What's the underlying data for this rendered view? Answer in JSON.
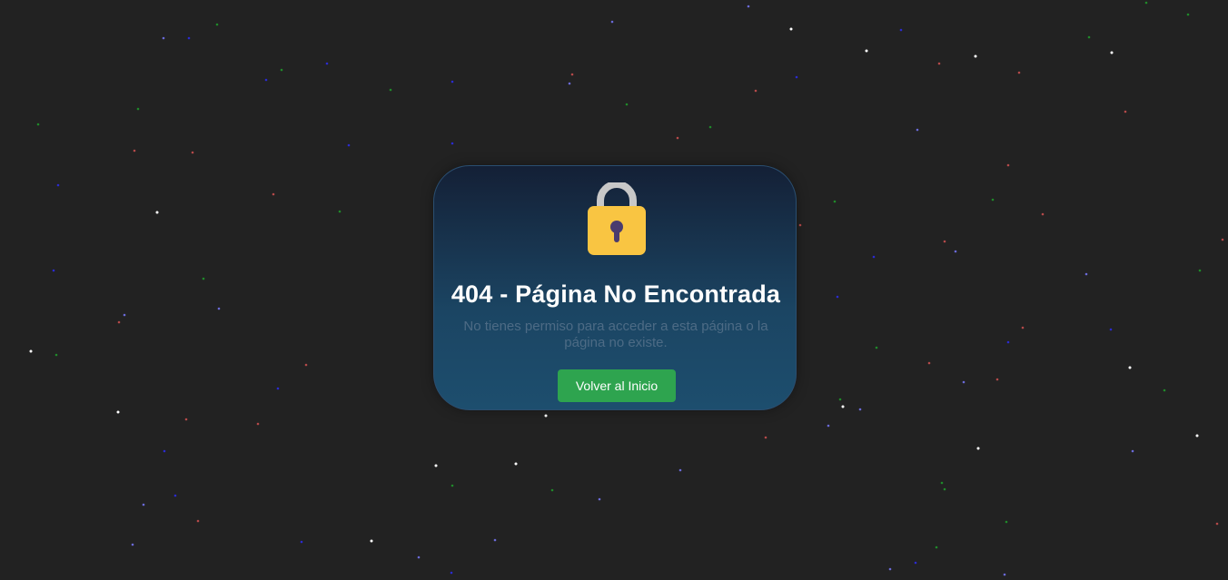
{
  "page": {
    "title": "404 - Página No Encontrada",
    "message": "No tienes permiso para acceder a esta página o la página no existe.",
    "button_label": "Volver al Inicio",
    "icon": "lock-icon"
  },
  "colors": {
    "background": "#222222",
    "button": "#2ea44f",
    "lock_body": "#f9c542",
    "lock_shackle": "#c8c8c8",
    "keyhole": "#4a3b6e"
  }
}
